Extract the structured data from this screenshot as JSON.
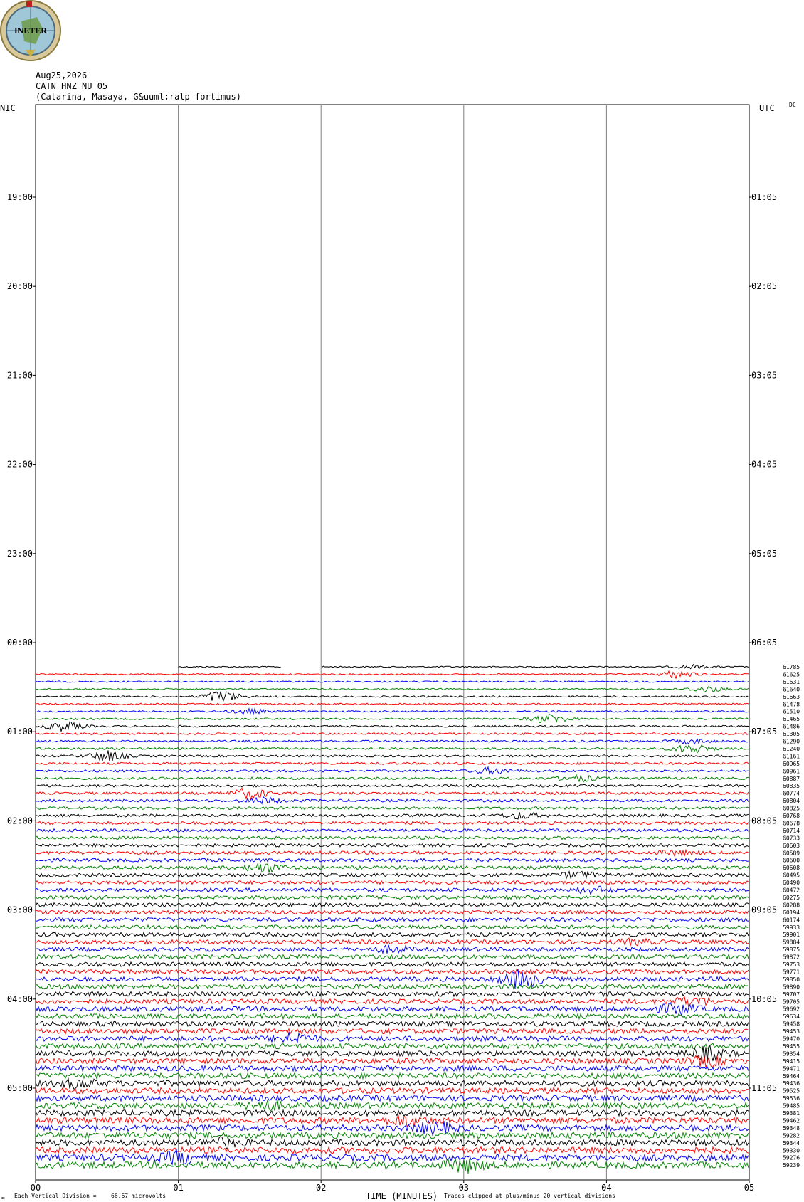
{
  "logo": {
    "text": "INETER"
  },
  "header": {
    "date": "Aug25,2026",
    "station": "CATN HNZ NU 05",
    "location": "(Catarina, Masaya, G&uuml;ralp fortimus)"
  },
  "corner_labels": {
    "left": "NIC",
    "right": "UTC",
    "dc": "DC"
  },
  "footer": {
    "division_text": "Each Vertical Division =",
    "division_value": "66.67 microvolts",
    "xlabel": "TIME (MINUTES)",
    "clip_note": "Traces clipped at plus/minus 20 vertical divisions"
  },
  "colors": {
    "trace_cycle": [
      "#000000",
      "#ff0000",
      "#0000ff",
      "#008000"
    ],
    "grid": "#808080"
  },
  "chart_data": {
    "type": "line",
    "title": "",
    "xlabel": "TIME (MINUTES)",
    "x_ticks": [
      "00",
      "01",
      "02",
      "03",
      "04",
      "05"
    ],
    "xlim": [
      0,
      5
    ],
    "hours_per_row": 0.0833,
    "left_hour_labels": [
      "19:00",
      "20:00",
      "21:00",
      "22:00",
      "23:00",
      "00:00",
      "01:00",
      "02:00",
      "03:00",
      "04:00",
      "05:00"
    ],
    "right_hour_labels": [
      "01:05",
      "02:05",
      "03:05",
      "04:05",
      "05:05",
      "06:05",
      "07:05",
      "08:05",
      "09:05",
      "10:05",
      "11:05"
    ],
    "first_trace_start_minute": 1.0,
    "gap_minutes": [
      1.72,
      2.0
    ],
    "trace_offsets": [
      61785,
      61625,
      61631,
      61640,
      61663,
      61478,
      61510,
      61465,
      61486,
      61305,
      61290,
      61240,
      61161,
      60965,
      60961,
      60887,
      60835,
      60774,
      60804,
      60825,
      60768,
      60678,
      60714,
      60733,
      60603,
      60589,
      60600,
      60608,
      60495,
      60490,
      60472,
      60275,
      60288,
      60194,
      60174,
      59933,
      59901,
      59884,
      59875,
      59872,
      59753,
      59771,
      59850,
      59890,
      59707,
      59705,
      59692,
      59634,
      59458,
      59453,
      59470,
      59455,
      59354,
      59415,
      59471,
      59464,
      59436,
      59525,
      59536,
      59485,
      59381,
      59462,
      59348,
      59282,
      59344,
      59330,
      59276,
      59239
    ],
    "events": [
      {
        "row": 0,
        "minute": 4.6,
        "amp": 2.5
      },
      {
        "row": 1,
        "minute": 4.5,
        "amp": 5
      },
      {
        "row": 3,
        "minute": 4.7,
        "amp": 4
      },
      {
        "row": 4,
        "minute": 1.3,
        "amp": 8
      },
      {
        "row": 6,
        "minute": 1.5,
        "amp": 3
      },
      {
        "row": 7,
        "minute": 3.6,
        "amp": 6
      },
      {
        "row": 8,
        "minute": 0.2,
        "amp": 6
      },
      {
        "row": 10,
        "minute": 4.6,
        "amp": 3
      },
      {
        "row": 11,
        "minute": 4.6,
        "amp": 6
      },
      {
        "row": 12,
        "minute": 0.5,
        "amp": 7
      },
      {
        "row": 14,
        "minute": 3.2,
        "amp": 4
      },
      {
        "row": 15,
        "minute": 3.8,
        "amp": 4
      },
      {
        "row": 17,
        "minute": 1.5,
        "amp": 7
      },
      {
        "row": 18,
        "minute": 1.6,
        "amp": 4
      },
      {
        "row": 20,
        "minute": 3.4,
        "amp": 4
      },
      {
        "row": 25,
        "minute": 4.5,
        "amp": 3
      },
      {
        "row": 27,
        "minute": 1.6,
        "amp": 6
      },
      {
        "row": 28,
        "minute": 3.8,
        "amp": 4
      },
      {
        "row": 30,
        "minute": 3.9,
        "amp": 4
      },
      {
        "row": 37,
        "minute": 4.2,
        "amp": 3
      },
      {
        "row": 38,
        "minute": 2.5,
        "amp": 4
      },
      {
        "row": 42,
        "minute": 3.4,
        "amp": 12
      },
      {
        "row": 45,
        "minute": 4.6,
        "amp": 6
      },
      {
        "row": 46,
        "minute": 4.5,
        "amp": 7
      },
      {
        "row": 50,
        "minute": 1.8,
        "amp": 7
      },
      {
        "row": 52,
        "minute": 4.7,
        "amp": 8
      },
      {
        "row": 53,
        "minute": 4.7,
        "amp": 6
      },
      {
        "row": 56,
        "minute": 0.3,
        "amp": 5
      },
      {
        "row": 59,
        "minute": 1.6,
        "amp": 6
      },
      {
        "row": 61,
        "minute": 2.6,
        "amp": 6
      },
      {
        "row": 62,
        "minute": 2.8,
        "amp": 7
      },
      {
        "row": 64,
        "minute": 1.3,
        "amp": 5
      },
      {
        "row": 66,
        "minute": 1.0,
        "amp": 7
      },
      {
        "row": 67,
        "minute": 3.0,
        "amp": 8
      }
    ]
  }
}
